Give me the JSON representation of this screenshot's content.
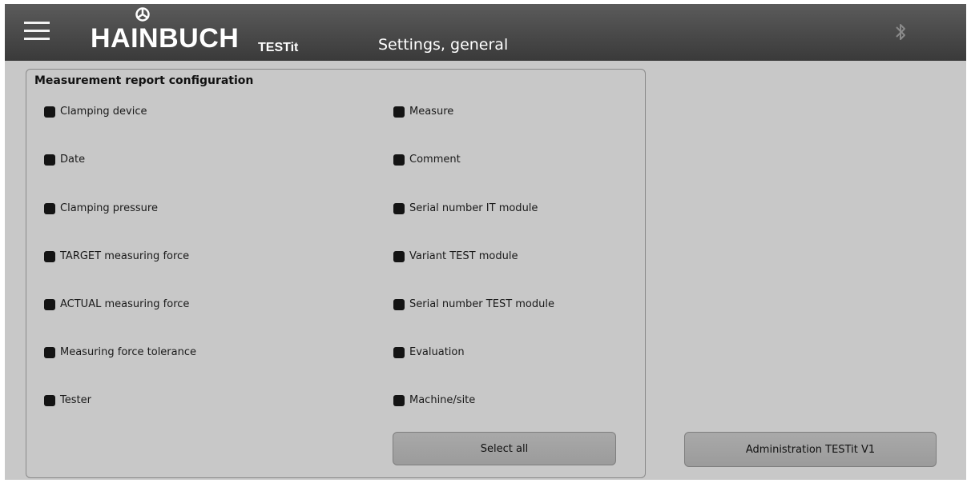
{
  "header": {
    "brand": "HAINBUCH",
    "app_name": "TESTit",
    "page_title": "Settings, general"
  },
  "panel": {
    "title": "Measurement report configuration",
    "left_options": [
      {
        "label": "Clamping device",
        "checked": true
      },
      {
        "label": "Date",
        "checked": true
      },
      {
        "label": "Clamping pressure",
        "checked": true
      },
      {
        "label": "TARGET measuring force",
        "checked": true
      },
      {
        "label": "ACTUAL measuring force",
        "checked": true
      },
      {
        "label": "Measuring force tolerance",
        "checked": true
      },
      {
        "label": "Tester",
        "checked": true
      }
    ],
    "right_options": [
      {
        "label": "Measure",
        "checked": true
      },
      {
        "label": "Comment",
        "checked": true
      },
      {
        "label": "Serial number IT module",
        "checked": true
      },
      {
        "label": "Variant TEST module",
        "checked": true
      },
      {
        "label": "Serial number TEST module",
        "checked": true
      },
      {
        "label": "Evaluation",
        "checked": true
      },
      {
        "label": "Machine/site",
        "checked": true
      }
    ],
    "select_all_label": "Select all"
  },
  "admin_button_label": "Administration TESTit V1",
  "colors": {
    "header": "#4a4a4a",
    "background": "#c8c8c8",
    "button": "#a3a3a3",
    "checkbox": "#141414"
  },
  "icons": {
    "menu": "hamburger-menu-icon",
    "bluetooth": "bluetooth-icon",
    "logo": "hainbuch-logo-mark"
  }
}
